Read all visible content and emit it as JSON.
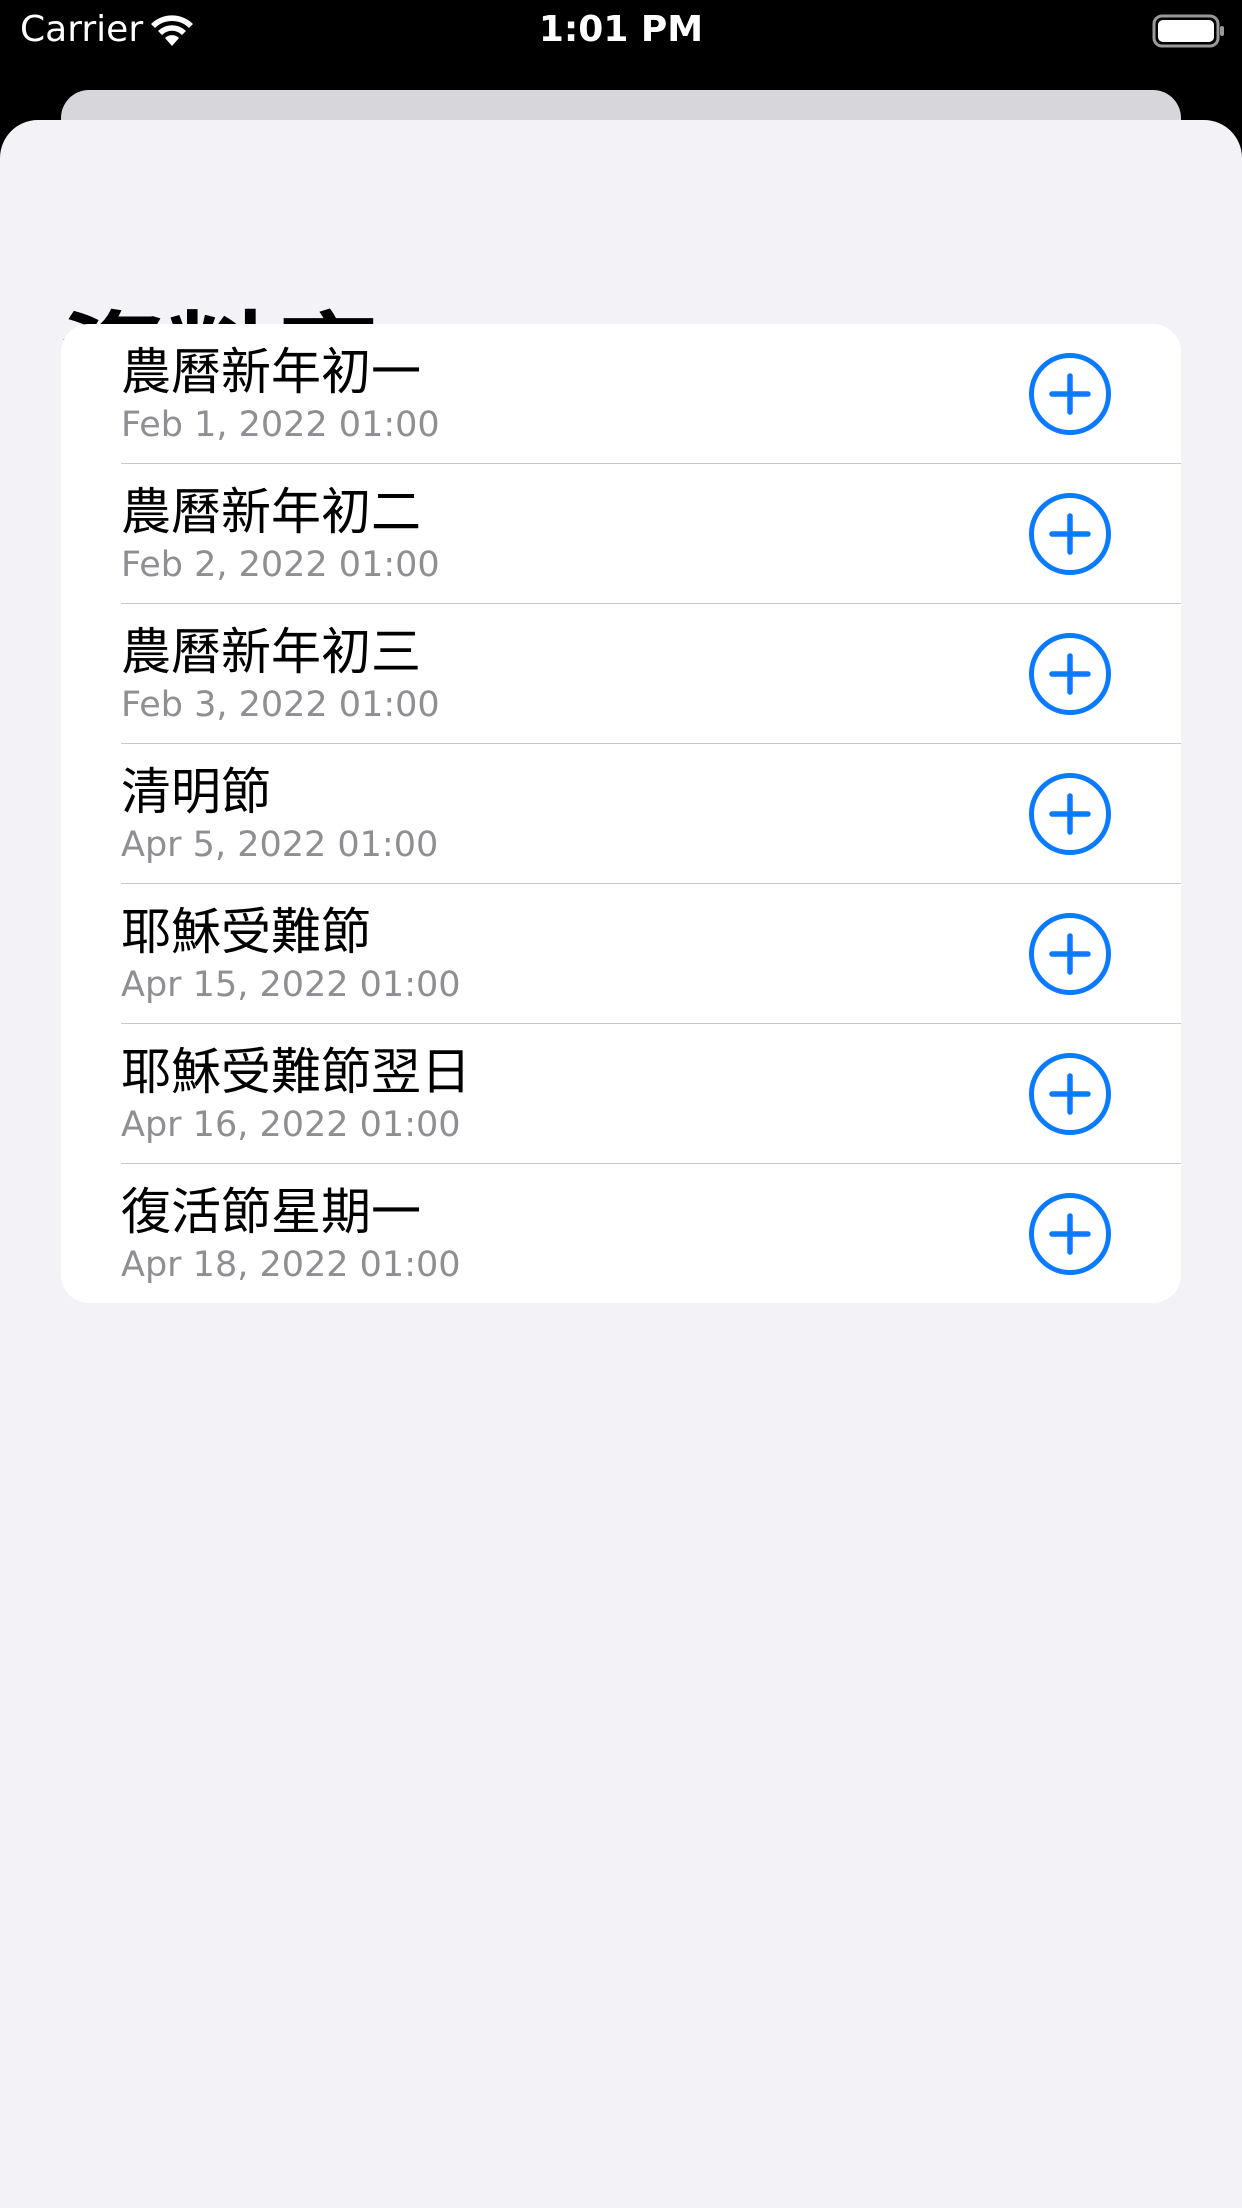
{
  "status_bar": {
    "carrier": "Carrier",
    "time": "1:01 PM",
    "wifi_icon": "wifi-icon",
    "battery_icon": "battery-icon"
  },
  "page": {
    "title": "資料庫"
  },
  "colors": {
    "accent": "#0a7aff",
    "sheet_background": "#f2f2f7",
    "secondary_text": "#8e8e93"
  },
  "list": {
    "items": [
      {
        "title": "農曆新年初一",
        "date": "Feb 1, 2022 01:00",
        "action_icon": "plus-circle-icon"
      },
      {
        "title": "農曆新年初二",
        "date": "Feb 2, 2022 01:00",
        "action_icon": "plus-circle-icon"
      },
      {
        "title": "農曆新年初三",
        "date": "Feb 3, 2022 01:00",
        "action_icon": "plus-circle-icon"
      },
      {
        "title": "清明節",
        "date": "Apr 5, 2022 01:00",
        "action_icon": "plus-circle-icon"
      },
      {
        "title": "耶穌受難節",
        "date": "Apr 15, 2022 01:00",
        "action_icon": "plus-circle-icon"
      },
      {
        "title": "耶穌受難節翌日",
        "date": "Apr 16, 2022 01:00",
        "action_icon": "plus-circle-icon"
      },
      {
        "title": "復活節星期一",
        "date": "Apr 18, 2022 01:00",
        "action_icon": "plus-circle-icon"
      }
    ]
  }
}
